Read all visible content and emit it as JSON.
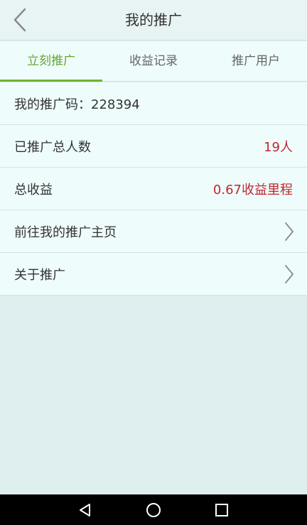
{
  "header": {
    "title": "我的推广"
  },
  "tabs": [
    {
      "label": "立刻推广",
      "active": true
    },
    {
      "label": "收益记录",
      "active": false
    },
    {
      "label": "推广用户",
      "active": false
    }
  ],
  "rows": {
    "promo_code": {
      "label": "我的推广码：228394"
    },
    "total_people": {
      "label": "已推广总人数",
      "value": "19人"
    },
    "total_earnings": {
      "label": "总收益",
      "value": "0.67收益里程"
    },
    "home_page": {
      "label": "前往我的推广主页"
    },
    "about": {
      "label": "关于推广"
    }
  },
  "colors": {
    "accent": "#6eb32d",
    "value_red": "#c0282d",
    "background": "#dfeeee"
  },
  "icons": [
    "back-icon",
    "chevron-right-icon",
    "nav-back-icon",
    "nav-home-icon",
    "nav-recents-icon"
  ]
}
